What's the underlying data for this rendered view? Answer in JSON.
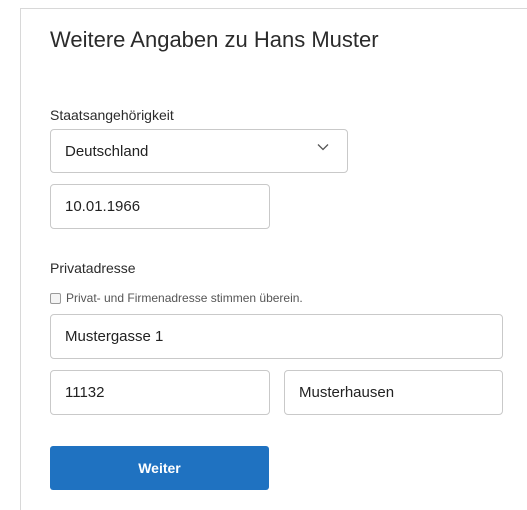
{
  "title": "Weitere Angaben zu Hans Muster",
  "nationality": {
    "label": "Staatsangehörigkeit",
    "selected": "Deutschland",
    "icon": "chevron-down-icon"
  },
  "birthdate": {
    "value": "10.01.1966"
  },
  "address": {
    "label": "Privatadresse",
    "same_as_company_label": "Privat- und Firmenadresse stimmen überein.",
    "same_as_company_checked": false,
    "street": "Mustergasse 1",
    "zip": "11132",
    "city": "Musterhausen"
  },
  "actions": {
    "next_label": "Weiter"
  },
  "colors": {
    "primary": "#1f72c1",
    "border": "#c9c9c9"
  }
}
